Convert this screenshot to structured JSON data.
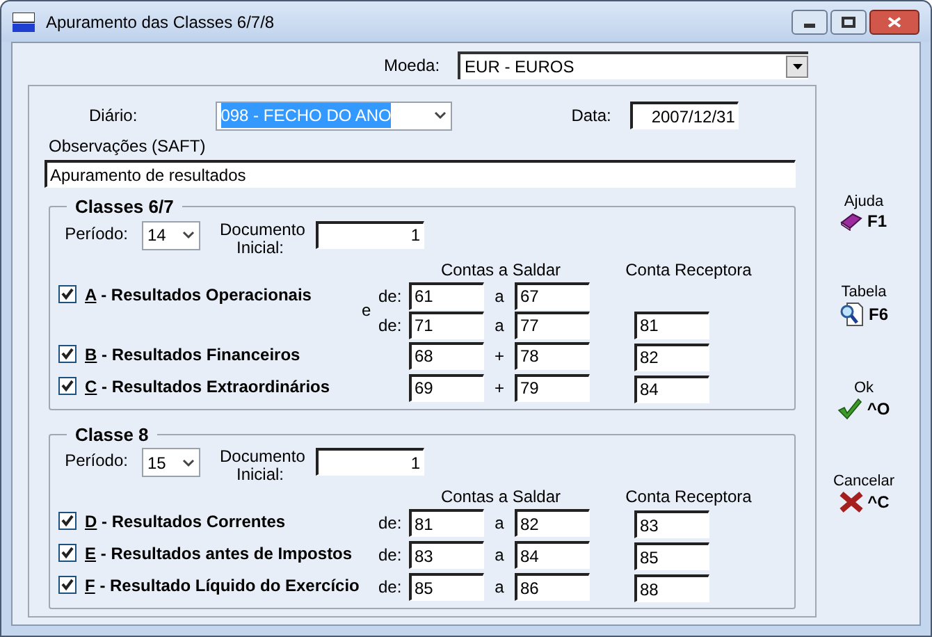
{
  "window": {
    "title": "Apuramento das Classes 6/7/8"
  },
  "moeda": {
    "label": "Moeda:",
    "value": "EUR - EUROS"
  },
  "diario": {
    "label": "Diário:",
    "value": "098 - FECHO DO ANO",
    "highlighted": true
  },
  "data": {
    "label": "Data:",
    "value": "2007/12/31"
  },
  "observacoes": {
    "label": "Observações (SAFT)",
    "value": "Apuramento de resultados"
  },
  "groups": [
    {
      "title": "Classes 6/7",
      "periodo_label": "Período:",
      "periodo": "14",
      "documento_label": "Documento Inicial:",
      "documento": "1",
      "header_contas": "Contas a Saldar",
      "header_receptora": "Conta Receptora",
      "rows": [
        {
          "mnemonic": "A",
          "label": "- Resultados Operacionais",
          "checked": true,
          "conjunction": "e",
          "receptor": "81",
          "ranges": [
            {
              "prefix": "de:",
              "from": "61",
              "joiner": "a",
              "to": "67"
            },
            {
              "prefix": "de:",
              "from": "71",
              "joiner": "a",
              "to": "77"
            }
          ]
        },
        {
          "mnemonic": "B",
          "label": "- Resultados Financeiros",
          "checked": true,
          "receptor": "82",
          "ranges": [
            {
              "from": "68",
              "joiner": "+",
              "to": "78"
            }
          ]
        },
        {
          "mnemonic": "C",
          "label": "- Resultados Extraordinários",
          "checked": true,
          "receptor": "84",
          "ranges": [
            {
              "from": "69",
              "joiner": "+",
              "to": "79"
            }
          ]
        }
      ]
    },
    {
      "title": "Classe 8",
      "periodo_label": "Período:",
      "periodo": "15",
      "documento_label": "Documento Inicial:",
      "documento": "1",
      "header_contas": "Contas a Saldar",
      "header_receptora": "Conta Receptora",
      "rows": [
        {
          "mnemonic": "D",
          "label": "- Resultados Correntes",
          "checked": true,
          "receptor": "83",
          "ranges": [
            {
              "prefix": "de:",
              "from": "81",
              "joiner": "a",
              "to": "82"
            }
          ]
        },
        {
          "mnemonic": "E",
          "label": "- Resultados antes de Impostos",
          "checked": true,
          "receptor": "85",
          "ranges": [
            {
              "prefix": "de:",
              "from": "83",
              "joiner": "a",
              "to": "84"
            }
          ]
        },
        {
          "mnemonic": "F",
          "label": "- Resultado Líquido do Exercício",
          "checked": true,
          "receptor": "88",
          "ranges": [
            {
              "prefix": "de:",
              "from": "85",
              "joiner": "a",
              "to": "86"
            }
          ]
        }
      ]
    }
  ],
  "actions": [
    {
      "kind": "help",
      "label": "Ajuda",
      "shortcut": "F1"
    },
    {
      "kind": "table",
      "label": "Tabela",
      "shortcut": "F6"
    },
    {
      "kind": "ok",
      "label": "Ok",
      "shortcut": "^O"
    },
    {
      "kind": "cancel",
      "label": "Cancelar",
      "shortcut": "^C"
    }
  ]
}
